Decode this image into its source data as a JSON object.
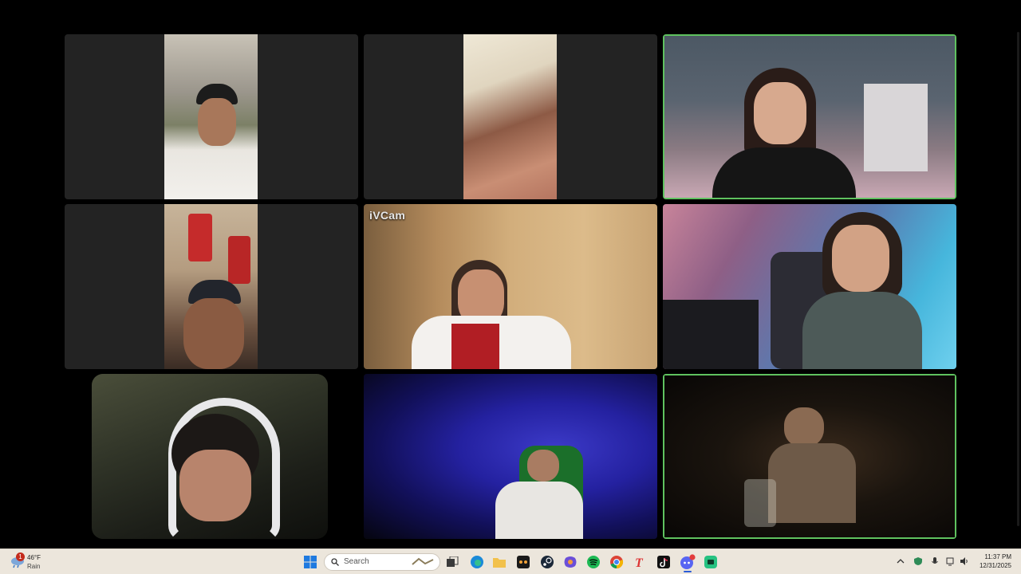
{
  "meeting": {
    "tiles": [
      {
        "name": "participant-1",
        "speaking": false,
        "label": ""
      },
      {
        "name": "participant-2",
        "speaking": false,
        "label": ""
      },
      {
        "name": "participant-3",
        "speaking": true,
        "label": ""
      },
      {
        "name": "participant-4",
        "speaking": false,
        "label": ""
      },
      {
        "name": "participant-5",
        "speaking": false,
        "label": "iVCam"
      },
      {
        "name": "participant-6",
        "speaking": false,
        "label": ""
      },
      {
        "name": "participant-7",
        "speaking": false,
        "label": ""
      },
      {
        "name": "participant-8",
        "speaking": false,
        "label": ""
      },
      {
        "name": "participant-9",
        "speaking": true,
        "label": ""
      }
    ],
    "speaking_color": "#5fc25f"
  },
  "taskbar": {
    "weather": {
      "temp": "46°F",
      "condition": "Rain",
      "badge": "1"
    },
    "search_placeholder": "Search",
    "apps": [
      {
        "name": "start-button",
        "icon": "windows-icon"
      },
      {
        "name": "task-view",
        "icon": "task-view-icon"
      },
      {
        "name": "edge",
        "icon": "edge-icon"
      },
      {
        "name": "file-explorer",
        "icon": "folder-icon"
      },
      {
        "name": "app-mask",
        "icon": "mask-app-icon"
      },
      {
        "name": "steam",
        "icon": "steam-icon"
      },
      {
        "name": "copilot",
        "icon": "copilot-icon"
      },
      {
        "name": "spotify",
        "icon": "spotify-icon"
      },
      {
        "name": "chrome",
        "icon": "chrome-icon"
      },
      {
        "name": "text-app",
        "icon": "text-t-icon"
      },
      {
        "name": "tiktok",
        "icon": "tiktok-icon"
      },
      {
        "name": "discord",
        "icon": "discord-icon",
        "badge": "9"
      },
      {
        "name": "app-green",
        "icon": "green-app-icon"
      }
    ],
    "clock": {
      "time": "11:37 PM",
      "date": "12/31/2025"
    }
  }
}
